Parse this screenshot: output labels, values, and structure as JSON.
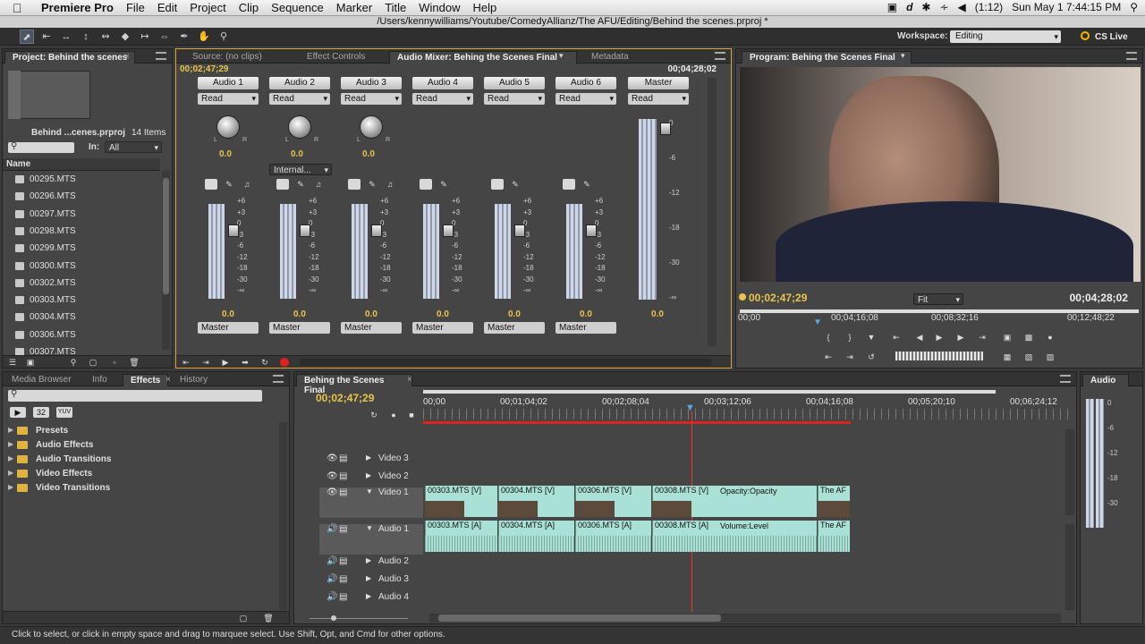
{
  "menubar": {
    "app_name": "Premiere Pro",
    "items": [
      "File",
      "Edit",
      "Project",
      "Clip",
      "Sequence",
      "Marker",
      "Title",
      "Window",
      "Help"
    ],
    "battery": "(1:12)",
    "datetime": "Sun May 1  7:44:15 PM"
  },
  "title_path": "/Users/kennywilliams/Youtube/ComedyAllianz/The AFU/Editing/Behind the scenes.prproj *",
  "toolbar": {
    "workspace_label": "Workspace:",
    "workspace_value": "Editing",
    "cs_live": "CS Live"
  },
  "project_panel": {
    "tab": "Project: Behind the scenes",
    "filename": "Behind ...cenes.prproj",
    "item_count": "14 Items",
    "in_label": "In:",
    "in_value": "All",
    "column_name": "Name",
    "items": [
      "00295.MTS",
      "00296.MTS",
      "00297.MTS",
      "00298.MTS",
      "00299.MTS",
      "00300.MTS",
      "00302.MTS",
      "00303.MTS",
      "00304.MTS",
      "00306.MTS",
      "00307.MTS"
    ]
  },
  "center_tabs": {
    "source": "Source: (no clips)",
    "effect_controls": "Effect Controls",
    "audio_mixer": "Audio Mixer: Behing the Scenes Final",
    "metadata": "Metadata"
  },
  "mixer": {
    "timecode_left": "00;02;47;29",
    "timecode_right": "00;04;28;02",
    "tracks": [
      "Audio 1",
      "Audio 2",
      "Audio 3",
      "Audio 4",
      "Audio 5",
      "Audio 6",
      "Master"
    ],
    "mode": "Read",
    "pan_value": "0.0",
    "internal": "Internal...",
    "scale": [
      "+6",
      "+3",
      "0",
      "-3",
      "-6",
      "-12",
      "-18",
      "-30",
      "-∞"
    ],
    "master_scale": [
      "0",
      "-6",
      "-12",
      "-18",
      "-30",
      "-∞"
    ],
    "fader_value": "0.0",
    "output": "Master",
    "pan_L": "L",
    "pan_R": "R"
  },
  "program_monitor": {
    "tab": "Program: Behing the Scenes Final",
    "timecode": "00;02;47;29",
    "duration": "00;04;28;02",
    "fit": "Fit",
    "ruler": [
      "00;00",
      "00;04;16;08",
      "00;08;32;16",
      "00;12;48;22"
    ]
  },
  "effects_panel": {
    "tabs": [
      "Media Browser",
      "Info",
      "Effects",
      "History"
    ],
    "presets_label_32": "32",
    "presets_label_yuv": "YUV",
    "folders": [
      "Presets",
      "Audio Effects",
      "Audio Transitions",
      "Video Effects",
      "Video Transitions"
    ]
  },
  "timeline": {
    "tab": "Behing the Scenes Final",
    "timecode": "00;02;47;29",
    "ruler": [
      "00;00",
      "00;01;04;02",
      "00;02;08;04",
      "00;03;12;06",
      "00;04;16;08",
      "00;05;20;10",
      "00;06;24;12"
    ],
    "video_tracks": [
      "Video 3",
      "Video 2",
      "Video 1"
    ],
    "audio_tracks": [
      "Audio 1",
      "Audio 2",
      "Audio 3",
      "Audio 4"
    ],
    "video_clips": [
      "00303.MTS [V]",
      "00304.MTS [V]",
      "00306.MTS [V]",
      "00308.MTS [V]",
      "The AF"
    ],
    "video_opacity": "Opacity:Opacity",
    "audio_clips": [
      "00303.MTS [A]",
      "00304.MTS [A]",
      "00306.MTS [A]",
      "00308.MTS [A]",
      "The AF"
    ],
    "audio_volume": "Volume:Level"
  },
  "audio_meter_panel": {
    "tab": "Audio",
    "scale": [
      "0",
      "-6",
      "-12",
      "-18",
      "-30"
    ]
  },
  "status": "Click to select, or click in empty space and drag to marquee select. Use Shift, Opt, and Cmd for other options."
}
